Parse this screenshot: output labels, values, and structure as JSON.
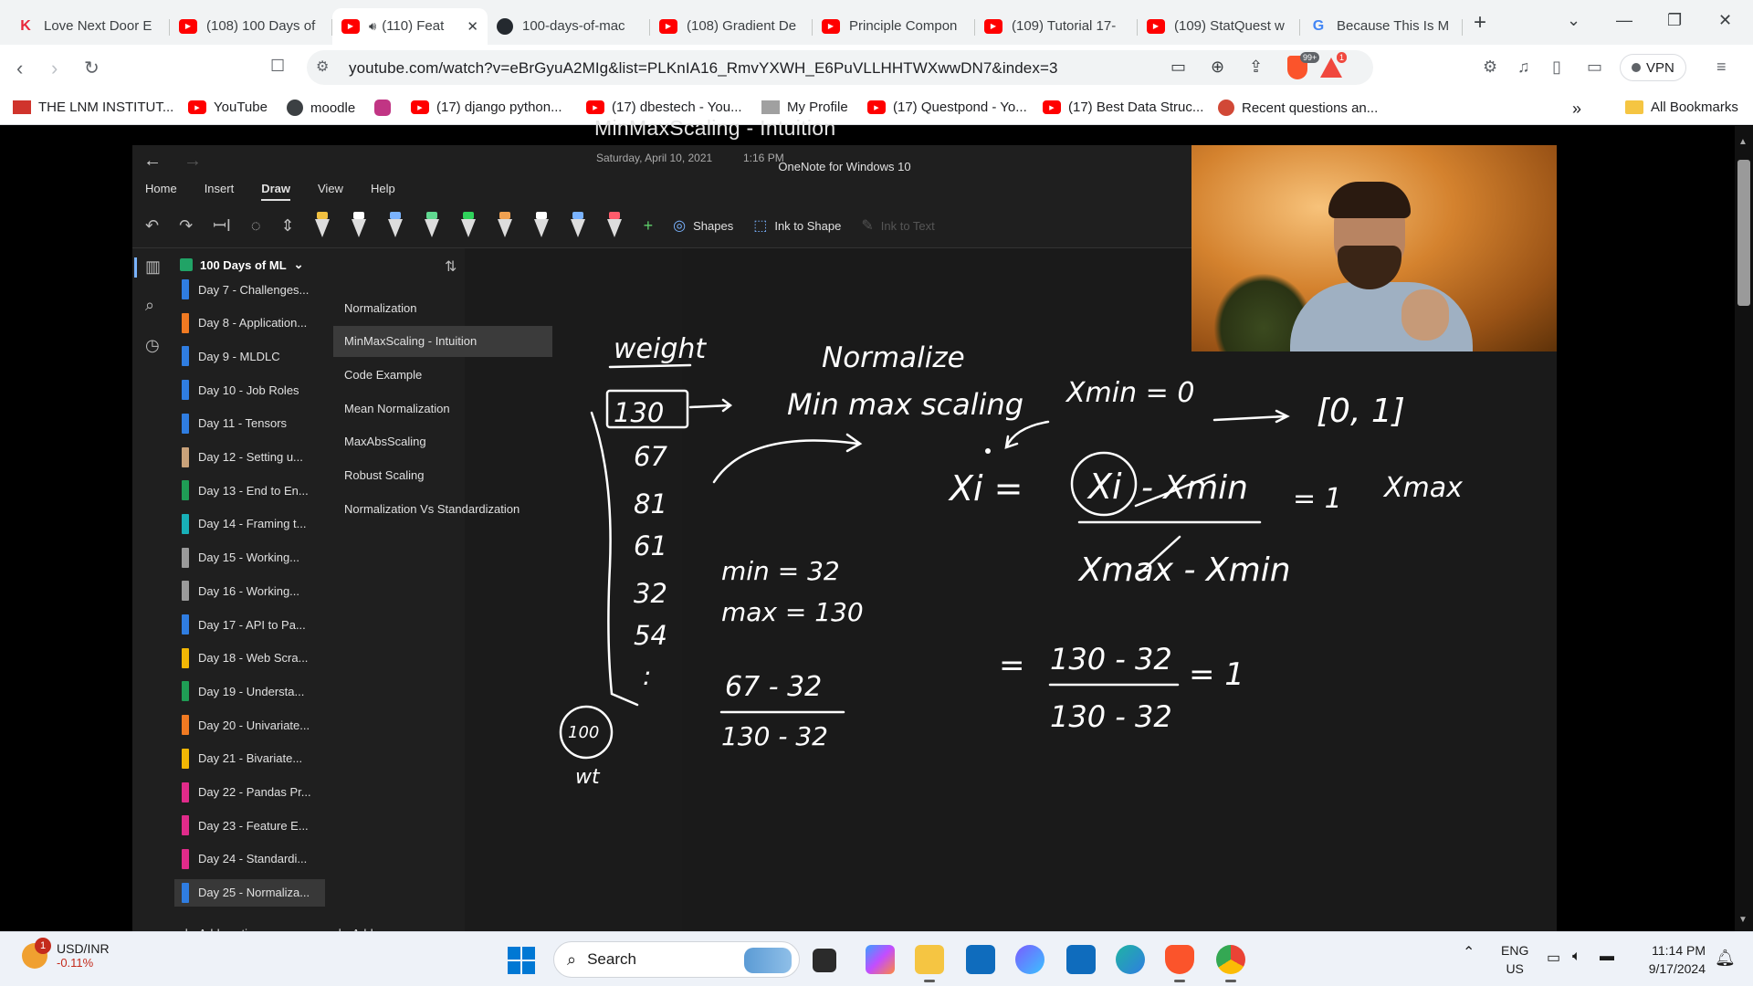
{
  "browser": {
    "tabs": [
      {
        "title": "Love Next Door E",
        "icon": "k-icon"
      },
      {
        "title": "(108) 100 Days of",
        "icon": "youtube-icon"
      },
      {
        "title": "(110) Feat",
        "icon": "youtube-icon",
        "active": true
      },
      {
        "title": "100-days-of-mac",
        "icon": "github-icon"
      },
      {
        "title": "(108) Gradient De",
        "icon": "youtube-icon"
      },
      {
        "title": "Principle Compon",
        "icon": "youtube-icon"
      },
      {
        "title": "(109) Tutorial 17-",
        "icon": "youtube-icon"
      },
      {
        "title": "(109) StatQuest w",
        "icon": "youtube-icon"
      },
      {
        "title": "Because This Is M",
        "icon": "google-icon"
      }
    ],
    "url": "youtube.com/watch?v=eBrGyuA2MIg&list=PLKnIA16_RmvYXWH_E6PuVLLHHTWXwwDN7&index=3",
    "shield_badge": "99+",
    "rewards_badge": "1",
    "vpn_label": "VPN",
    "bookmarks": [
      {
        "label": "THE LNM INSTITUT...",
        "icon": "lnm-icon"
      },
      {
        "label": "YouTube",
        "icon": "youtube-icon"
      },
      {
        "label": "moodle",
        "icon": "moodle-icon"
      },
      {
        "label": "",
        "icon": "instagram-icon"
      },
      {
        "label": "(17) django python...",
        "icon": "youtube-icon"
      },
      {
        "label": "(17) dbestech - You...",
        "icon": "youtube-icon"
      },
      {
        "label": "My Profile",
        "icon": "profile-icon"
      },
      {
        "label": "(17) Questpond - Yo...",
        "icon": "youtube-icon"
      },
      {
        "label": "(17) Best Data Struc...",
        "icon": "youtube-icon"
      },
      {
        "label": "Recent questions an...",
        "icon": "rq-icon"
      }
    ],
    "all_bookmarks": "All Bookmarks"
  },
  "onenote": {
    "app_title": "OneNote for Windows 10",
    "menu": [
      "Home",
      "Insert",
      "Draw",
      "View",
      "Help"
    ],
    "tools": {
      "shapes": "Shapes",
      "ink_to_shape": "Ink to Shape",
      "ink_to_text": "Ink to Text"
    },
    "pen_colors": [
      "#f0c040",
      "#ffffff",
      "#7ab3ff",
      "#60d890",
      "#2fd35b",
      "#f0a050",
      "#ffffff",
      "#7ab3ff",
      "#ff5b6b"
    ],
    "notebook": "100 Days of ML",
    "sections": [
      {
        "label": "Day 7 - Challenges...",
        "color": "#2f7de1"
      },
      {
        "label": "Day 8 - Application...",
        "color": "#f07a22"
      },
      {
        "label": "Day 9 - MLDLC",
        "color": "#2f7de1"
      },
      {
        "label": "Day 10 - Job Roles",
        "color": "#2f7de1"
      },
      {
        "label": "Day 11 - Tensors",
        "color": "#2f7de1"
      },
      {
        "label": "Day 12 - Setting u...",
        "color": "#c9a27a"
      },
      {
        "label": "Day 13 - End to En...",
        "color": "#1f9d55"
      },
      {
        "label": "Day 14 - Framing t...",
        "color": "#18b0b8"
      },
      {
        "label": "Day 15 - Working...",
        "color": "#9a9a9a"
      },
      {
        "label": "Day 16 - Working...",
        "color": "#9a9a9a"
      },
      {
        "label": "Day 17 - API to Pa...",
        "color": "#2f7de1"
      },
      {
        "label": "Day 18 - Web Scra...",
        "color": "#f2b705"
      },
      {
        "label": "Day 19 - Understa...",
        "color": "#1f9d55"
      },
      {
        "label": "Day 20 - Univariate...",
        "color": "#f07a22"
      },
      {
        "label": "Day 21 - Bivariate...",
        "color": "#f2b705"
      },
      {
        "label": "Day 22 - Pandas Pr...",
        "color": "#e02b8a"
      },
      {
        "label": "Day 23 - Feature E...",
        "color": "#e02b8a"
      },
      {
        "label": "Day 24 - Standardi...",
        "color": "#e02b8a"
      },
      {
        "label": "Day 25 - Normaliza...",
        "color": "#2f7de1",
        "selected": true
      }
    ],
    "pages": [
      {
        "label": "Normalization"
      },
      {
        "label": "MinMaxScaling - Intuition",
        "selected": true
      },
      {
        "label": "Code Example"
      },
      {
        "label": "Mean Normalization"
      },
      {
        "label": "MaxAbsScaling"
      },
      {
        "label": "Robust Scaling"
      },
      {
        "label": "Normalization Vs Standardization"
      }
    ],
    "add_section": "Add section",
    "add_page": "Add page",
    "page_title": "MinMaxScaling - Intuition",
    "page_date": "Saturday, April 10, 2021",
    "page_time": "1:16 PM",
    "ink": {
      "weight": "weight",
      "values": [
        "130",
        "67",
        "81",
        "61",
        "32",
        "54",
        ":"
      ],
      "normalize": "Normalize",
      "minmax": "Min max scaling",
      "xmin0": "Xmin = 0",
      "range": "[0, 1]",
      "xi_eq": "Xi =",
      "xi": "Xi",
      "numerator_rest": "- Xmin",
      "denominator": "Xmax - Xmin",
      "eq1": "= 1",
      "xmax": "Xmax",
      "min": "min = 32",
      "max": "max = 130",
      "frac1_num": "67 - 32",
      "frac1_den": "130 - 32",
      "eq_sym": "=",
      "frac2_num": "130 - 32",
      "frac2_den": "130 - 32",
      "eq_one": "= 1",
      "circle100": "100",
      "wt": "wt"
    }
  },
  "taskbar": {
    "ticker_name": "USD/INR",
    "ticker_change": "-0.11%",
    "ticker_badge": "1",
    "search": "Search",
    "lang1": "ENG",
    "lang2": "US",
    "time": "11:14 PM",
    "date": "9/17/2024"
  }
}
